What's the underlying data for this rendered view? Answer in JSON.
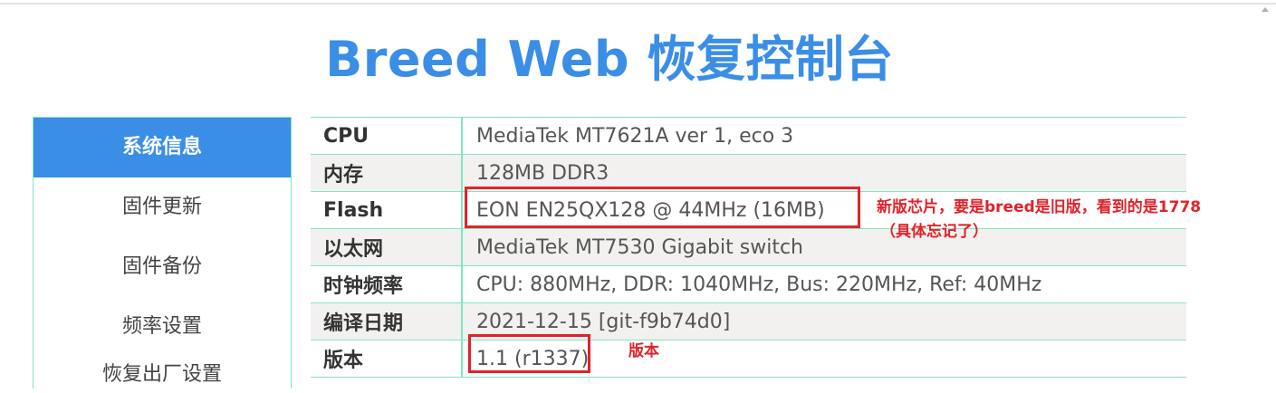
{
  "page": {
    "title": "Breed Web 恢复控制台"
  },
  "sidebar": {
    "items": [
      {
        "label": "系统信息",
        "active": true
      },
      {
        "label": "固件更新",
        "active": false
      },
      {
        "label": "固件备份",
        "active": false
      },
      {
        "label": "频率设置",
        "active": false
      },
      {
        "label": "恢复出厂设置",
        "active": false
      }
    ]
  },
  "system_info": {
    "rows": [
      {
        "key": "CPU",
        "value": "MediaTek MT7621A ver 1, eco 3"
      },
      {
        "key": "内存",
        "value": "128MB DDR3"
      },
      {
        "key": "Flash",
        "value": "EON EN25QX128 @ 44MHz (16MB)"
      },
      {
        "key": "以太网",
        "value": "MediaTek MT7530 Gigabit switch"
      },
      {
        "key": "时钟频率",
        "value": "CPU: 880MHz, DDR: 1040MHz, Bus: 220MHz, Ref: 40MHz"
      },
      {
        "key": "编译日期",
        "value": "2021-12-15 [git-f9b74d0]"
      },
      {
        "key": "版本",
        "value": "1.1 (r1337)"
      }
    ]
  },
  "annotations": {
    "flash_note_line1": "新版芯片，要是breed是旧版，看到的是1778",
    "flash_note_line2": "（具体忘记了）",
    "version_note": "版本"
  },
  "colors": {
    "accent": "#3a8ee6",
    "border": "#7fe6c6",
    "annotation": "#e0232a",
    "row_alt": "#f2f1ef"
  }
}
